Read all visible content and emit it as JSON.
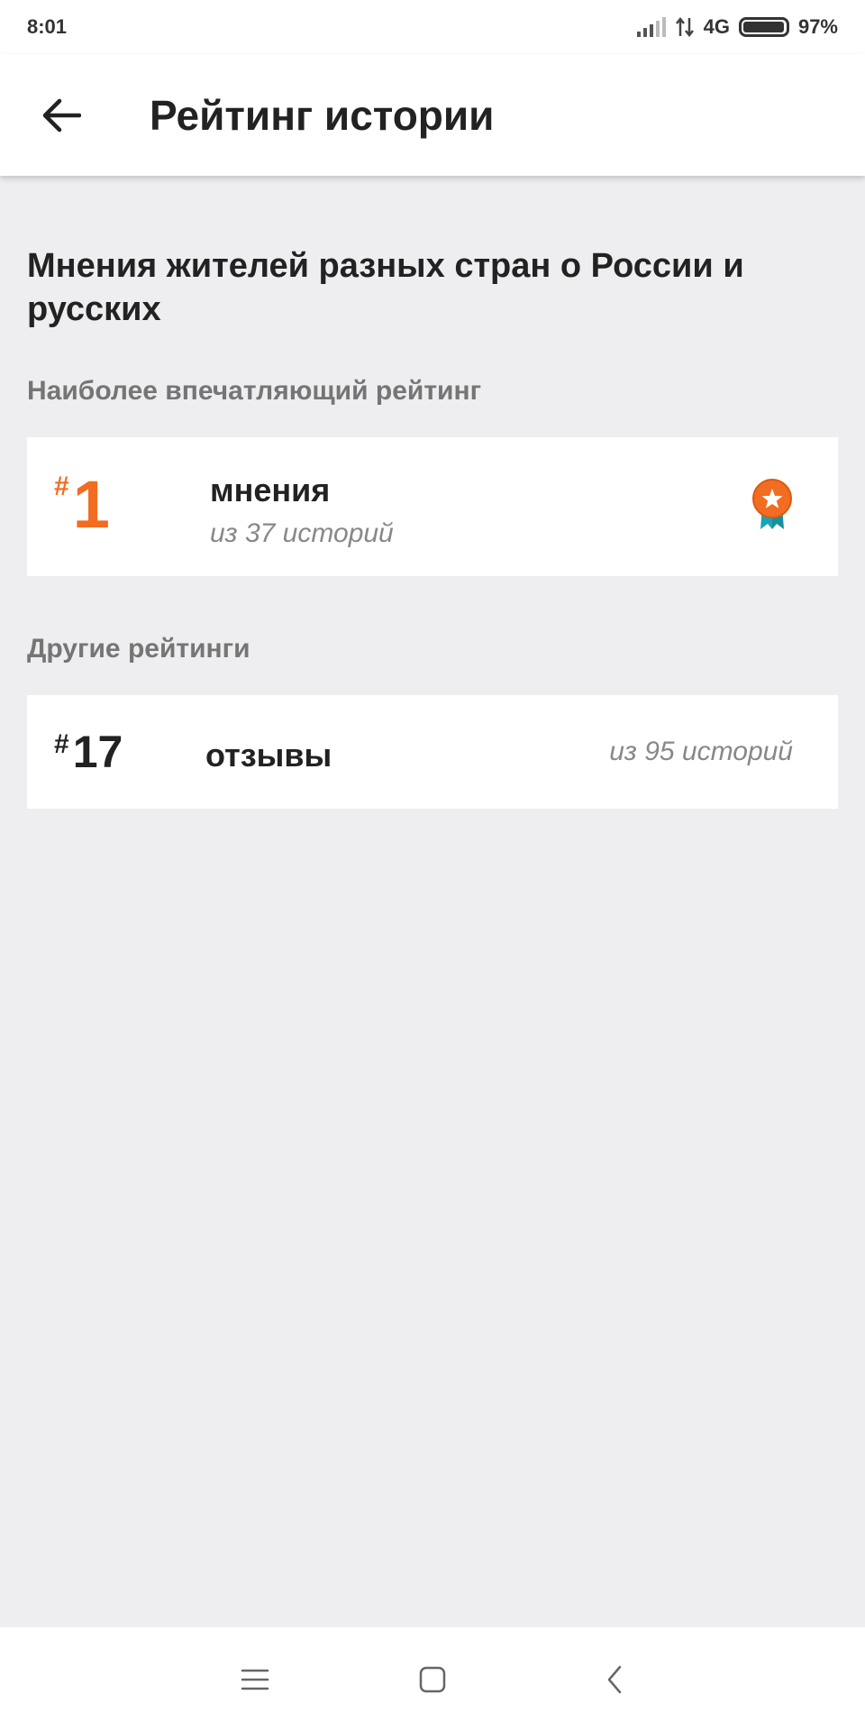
{
  "status_bar": {
    "time": "8:01",
    "network": "4G",
    "battery_text": "97%",
    "battery_level": 0.97
  },
  "app_bar": {
    "back_icon": "arrow-left-icon",
    "title": "Рейтинг истории"
  },
  "story": {
    "title": "Мнения жителей разных стран о России и русских"
  },
  "top_rating": {
    "section_label": "Наиболее впечатляющий рейтинг",
    "hash": "#",
    "rank": "1",
    "category": "мнения",
    "out_of": "из 37 историй",
    "icon": "medal-star-icon",
    "accent_color": "#f26d21",
    "ribbon_color": "#1aa3b5"
  },
  "other_ratings": {
    "section_label": "Другие рейтинги",
    "items": [
      {
        "hash": "#",
        "rank": "17",
        "category": "отзывы",
        "out_of": "из 95 историй"
      }
    ]
  },
  "nav_bar": {
    "menu_icon": "menu-icon",
    "home_icon": "home-square-icon",
    "back_icon": "back-chevron-icon"
  }
}
